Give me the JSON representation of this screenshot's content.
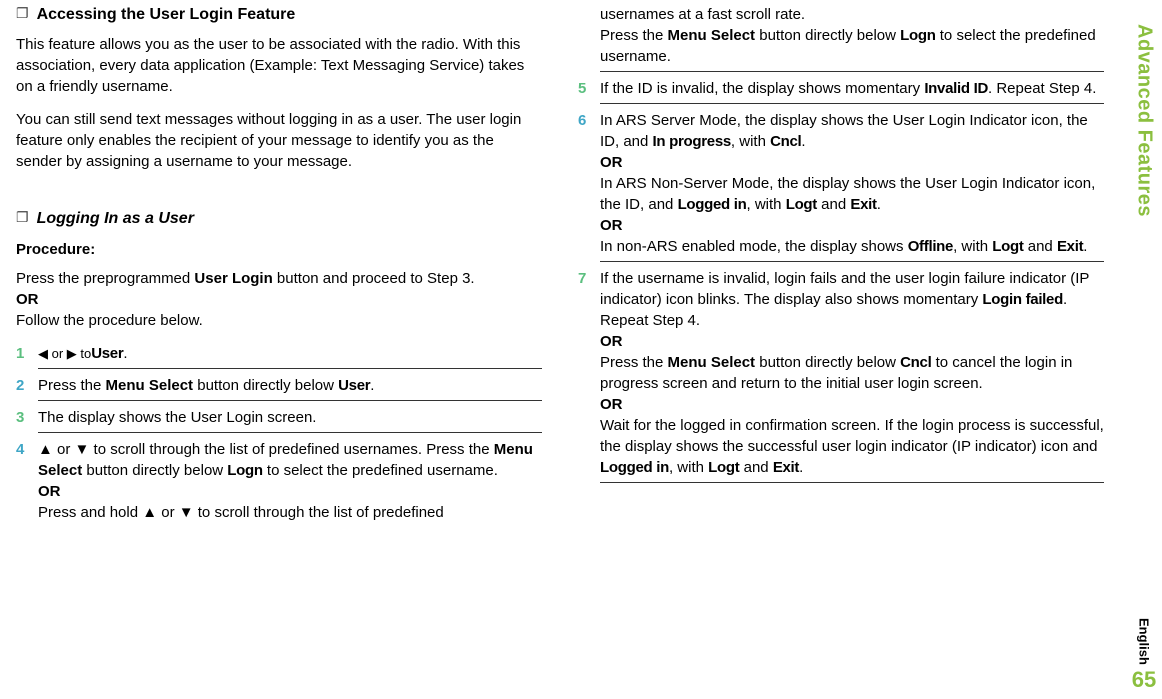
{
  "sidebar": {
    "title": "Advanced Features",
    "lang": "English",
    "page": "65"
  },
  "left": {
    "h1": "Accessing the User Login Feature",
    "p1": "This feature allows you as the user to be associated with the radio. With this association, every data application (Example: Text Messaging Service) takes on a friendly username.",
    "p2": "You can still send text messages without logging in as a user. The user login feature only enables the recipient of your message to identify you as the sender by assigning a username to your message.",
    "h2": "Logging In as a User",
    "proc": "Procedure:",
    "intro_a": "Press the preprogrammed ",
    "intro_b": "User Login",
    "intro_c": " button and proceed to Step 3.",
    "intro_or": "OR",
    "intro_d": "Follow the procedure below.",
    "step1_a": "◀ or ▶ to ",
    "step1_b": "User",
    "step1_c": ".",
    "step2_a": "Press the ",
    "step2_b": "Menu Select",
    "step2_c": " button directly below ",
    "step2_d": "User",
    "step2_e": ".",
    "step3": "The display shows the User Login screen.",
    "step4_a": "▲ or ▼ to scroll through the list of predefined usernames. Press the ",
    "step4_b": "Menu Select",
    "step4_c": " button directly below ",
    "step4_d": "Logn",
    "step4_e": " to select the predefined username.",
    "step4_or": "OR",
    "step4_f": "Press and hold ▲ or ▼ to scroll through the list of predefined"
  },
  "right": {
    "cont4_a": "usernames at a fast scroll rate.",
    "cont4_b": "Press the ",
    "cont4_c": "Menu Select",
    "cont4_d": " button directly below ",
    "cont4_e": "Logn",
    "cont4_f": " to select the predefined username.",
    "step5_a": "If the ID is invalid, the display shows momentary ",
    "step5_b": "Invalid ID",
    "step5_c": ". Repeat Step 4.",
    "step6_a": "In ARS Server Mode, the display shows the User Login Indicator icon, the ID, and ",
    "step6_b": "In progress",
    "step6_c": ", with ",
    "step6_d": "Cncl",
    "step6_e": ".",
    "step6_or1": "OR",
    "step6_f": "In ARS Non-Server Mode, the display shows the User Login Indicator icon, the ID, and ",
    "step6_g": "Logged in",
    "step6_h": ", with ",
    "step6_i": "Logt",
    "step6_j": " and ",
    "step6_k": "Exit",
    "step6_l": ".",
    "step6_or2": "OR",
    "step6_m": "In non-ARS enabled mode, the display shows ",
    "step6_n": "Offline",
    "step6_o": ", with ",
    "step6_p": "Logt",
    "step6_q": " and ",
    "step6_r": "Exit",
    "step6_s": ".",
    "step7_a": "If the username is invalid, login fails and the user login failure indicator (IP indicator) icon blinks. The display also shows momentary ",
    "step7_b": "Login failed",
    "step7_c": ". Repeat Step 4.",
    "step7_or1": "OR",
    "step7_d": "Press the ",
    "step7_e": "Menu Select",
    "step7_f": " button directly below ",
    "step7_g": "Cncl",
    "step7_h": " to cancel the login in progress screen and return to the initial user login screen.",
    "step7_or2": "OR",
    "step7_i": "Wait for the logged in confirmation screen. If the login process is successful, the display shows the successful user login indicator (IP indicator) icon and ",
    "step7_j": "Logged in",
    "step7_k": ", with ",
    "step7_l": "Logt",
    "step7_m": " and ",
    "step7_n": "Exit",
    "step7_o": "."
  }
}
